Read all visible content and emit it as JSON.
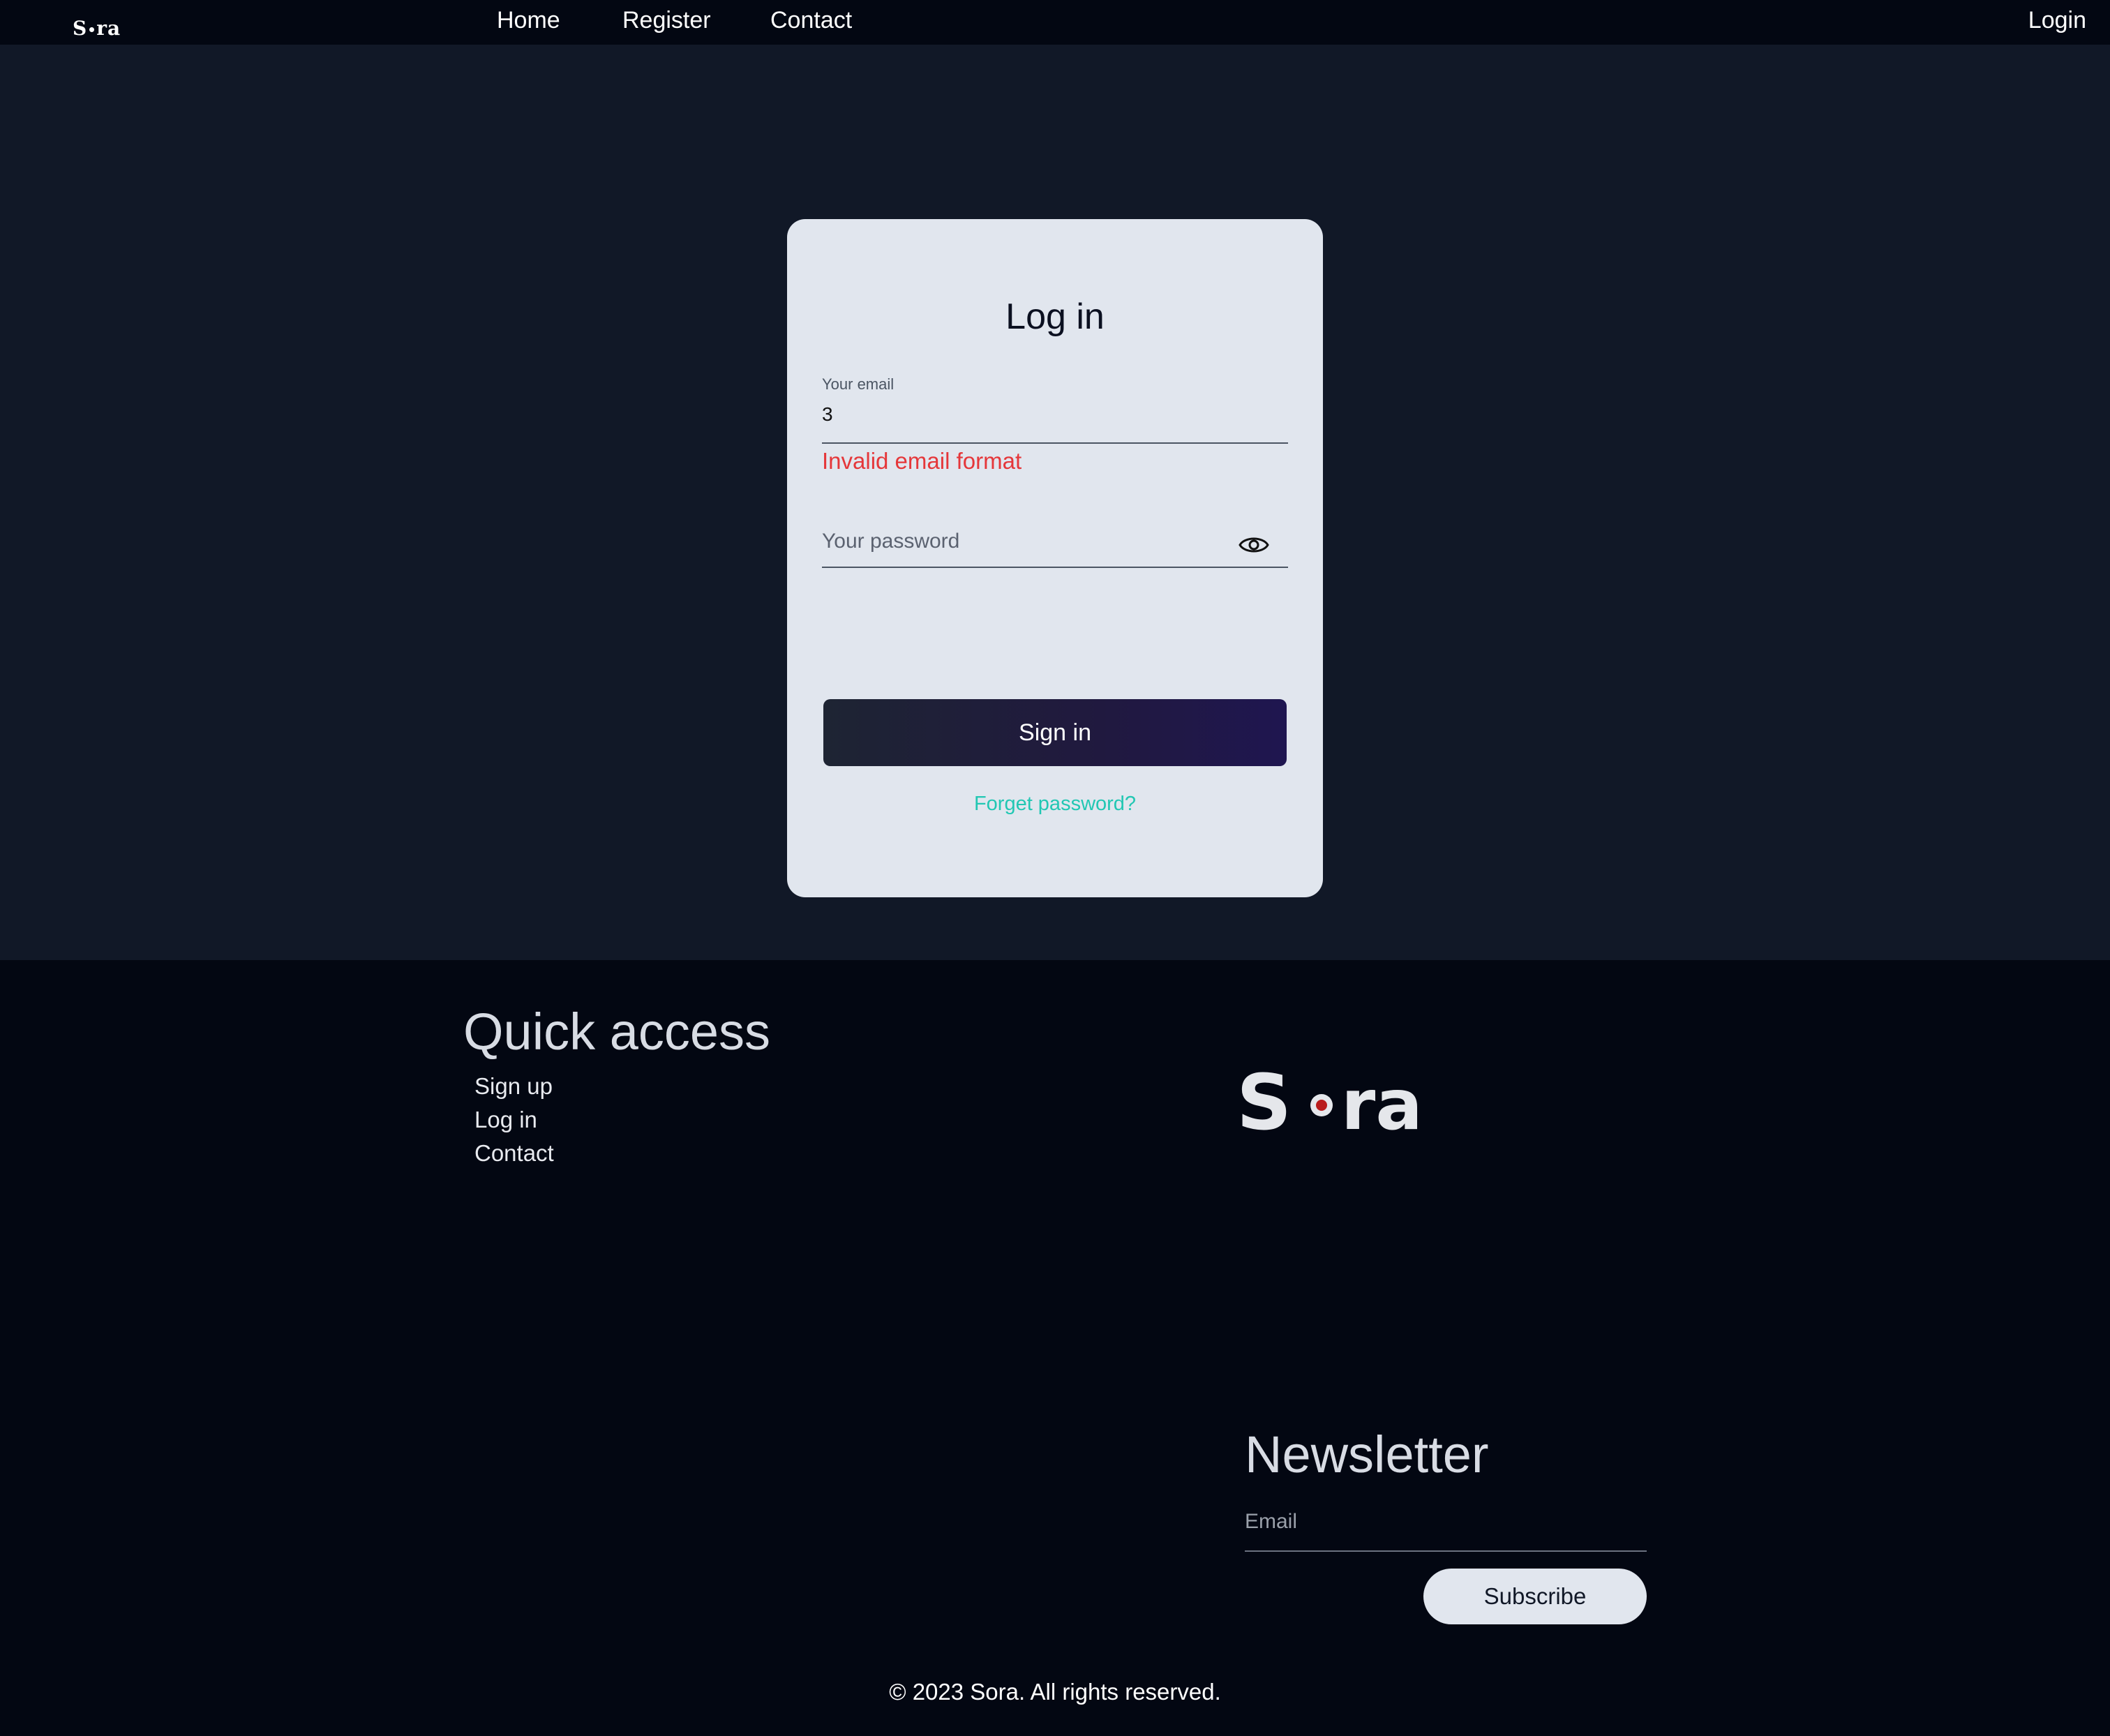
{
  "header": {
    "logo_text_left": "S",
    "logo_text_right": "ra",
    "nav": [
      "Home",
      "Register",
      "Contact"
    ],
    "login_label": "Login"
  },
  "login_card": {
    "title": "Log in",
    "email_label": "Your email",
    "email_value": "3",
    "email_error": "Invalid email format",
    "password_placeholder": "Your password",
    "signin_label": "Sign in",
    "forgot_label": "Forget password?"
  },
  "footer": {
    "quick_access_title": "Quick access",
    "quick_links": [
      "Sign up",
      "Log in",
      "Contact"
    ],
    "logo_text_left": "S",
    "logo_text_right": "ra",
    "newsletter_title": "Newsletter",
    "newsletter_placeholder": "Email",
    "subscribe_label": "Subscribe",
    "copyright": "© 2023 Sora. All rights reserved."
  },
  "colors": {
    "page_bg": "#111827",
    "bar_bg": "#030712",
    "card_bg": "#e1e6ee",
    "error": "#e5373a",
    "link_accent": "#22c7b3",
    "logo_dot": "#b91c1c"
  },
  "icons": {
    "password_toggle": "eye-icon"
  }
}
